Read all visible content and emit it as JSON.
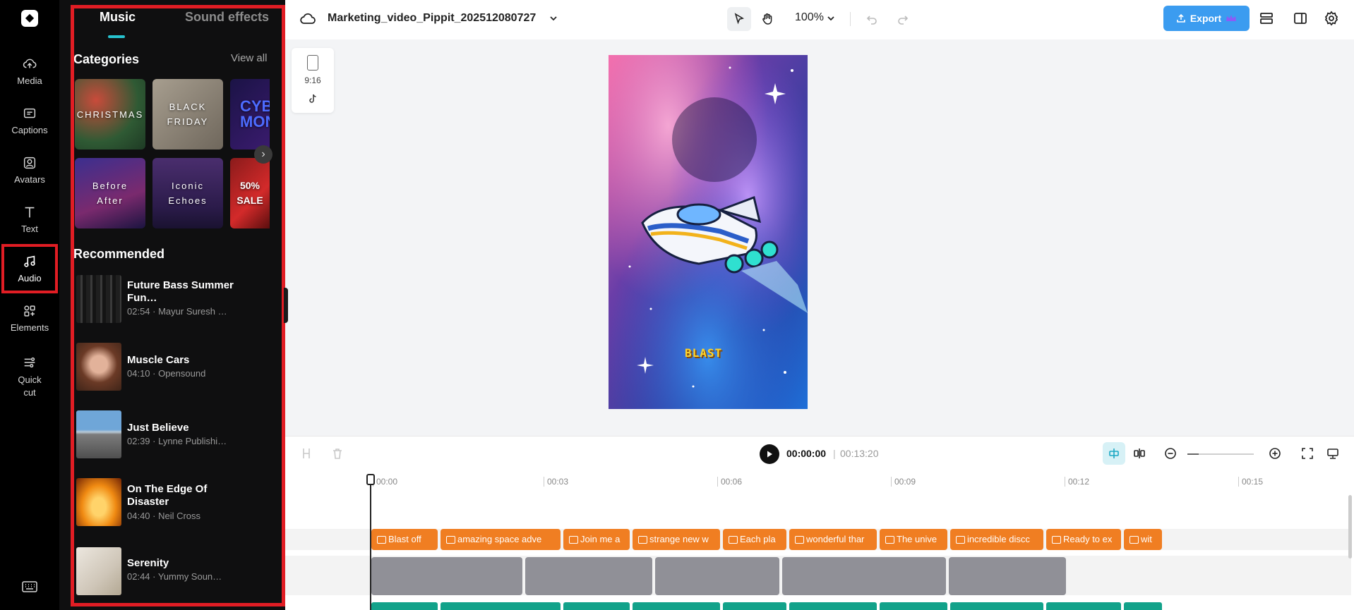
{
  "rail": {
    "items": [
      {
        "label": "Media",
        "icon": "cloud-upload-icon"
      },
      {
        "label": "Captions",
        "icon": "captions-icon"
      },
      {
        "label": "Avatars",
        "icon": "avatar-icon"
      },
      {
        "label": "Text",
        "icon": "text-icon"
      },
      {
        "label": "Audio",
        "icon": "music-note-icon",
        "active": true
      },
      {
        "label": "Elements",
        "icon": "elements-icon"
      },
      {
        "label": "Quick cut",
        "icon": "quick-cut-icon"
      }
    ]
  },
  "panel": {
    "tabs": {
      "music": "Music",
      "sound_effects": "Sound effects"
    },
    "categories_title": "Categories",
    "view_all": "View all",
    "categories": [
      "CHRISTMAS",
      "BLACK FRIDAY",
      "CYBER MONDAY",
      "Before After",
      "Iconic Echoes",
      "50% SALE"
    ],
    "recommended_title": "Recommended",
    "recommended": [
      {
        "title": "Future Bass Summer Fun…",
        "meta": "02:54 · Mayur Suresh …"
      },
      {
        "title": "Muscle Cars",
        "meta": "04:10 · Opensound"
      },
      {
        "title": "Just Believe",
        "meta": "02:39 · Lynne Publishi…"
      },
      {
        "title": "On The Edge Of Disaster",
        "meta": "04:40 · Neil Cross"
      },
      {
        "title": "Serenity",
        "meta": "02:44 · Yummy Soun…"
      }
    ]
  },
  "topbar": {
    "project_title": "Marketing_video_Pippit_202512080727",
    "zoom": "100%",
    "export_label": "Export"
  },
  "canvas": {
    "ratio": "9:16",
    "video_text": "BLAST"
  },
  "playback": {
    "current_time": "00:00:00",
    "separator": "|",
    "total_time": "00:13:20"
  },
  "timeline": {
    "ruler": [
      "00:00",
      "00:03",
      "00:06",
      "00:09",
      "00:12",
      "00:15"
    ],
    "captions": [
      "Blast off",
      "amazing space adve",
      "Join me a",
      "strange new w",
      "Each pla",
      "wonderful thar",
      "The unive",
      "incredible discc",
      "Ready to ex",
      "wit"
    ]
  },
  "colors": {
    "accent": "#27c3cf",
    "highlight": "#e11d24",
    "export": "#3b9cf0",
    "caption_clip": "#f07e22",
    "video_clip": "#909097",
    "audio_clip": "#12a28a"
  }
}
